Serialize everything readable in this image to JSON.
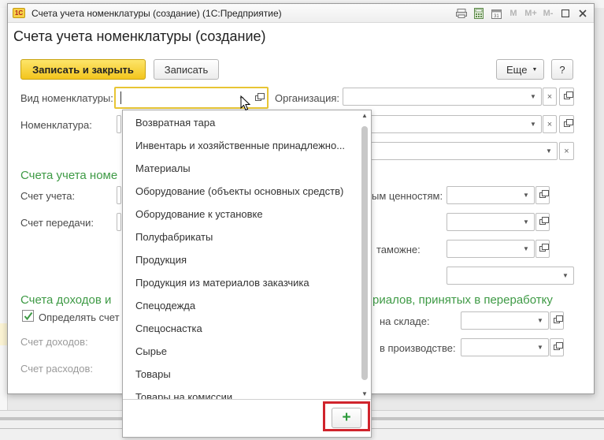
{
  "window": {
    "title": "Счета учета номенклатуры (создание)  (1С:Предприятие)",
    "form_title": "Счета учета номенклатуры (создание)",
    "titlebar_controls": [
      "M",
      "M+",
      "M-"
    ]
  },
  "toolbar": {
    "save_close_label": "Записать и закрыть",
    "save_label": "Записать",
    "more_label": "Еще",
    "help_label": "?"
  },
  "fields": {
    "item_type_label": "Вид номенклатуры:",
    "organization_label": "Организация:",
    "item_label": "Номенклатура:"
  },
  "sections": {
    "accounts_title": "Счета учета номе",
    "income_title": "Счета доходов и",
    "materials_title": "риалов, принятых в переработку"
  },
  "labels": {
    "account": "Счет учета:",
    "transfer_account": "Счет передачи:",
    "values_partial": "ым ценностям:",
    "customs_partial": "таможне:",
    "determine_check": "Определять счет",
    "income_account": "Счет доходов:",
    "expense_account": "Счет расходов:",
    "warehouse_partial": "на складе:",
    "production_partial": "в производстве:"
  },
  "dropdown": {
    "items": [
      "Возвратная тара",
      "Инвентарь и хозяйственные принадлежно...",
      "Материалы",
      "Оборудование (объекты основных средств)",
      "Оборудование к установке",
      "Полуфабрикаты",
      "Продукция",
      "Продукция из материалов заказчика",
      "Спецодежда",
      "Спецоснастка",
      "Сырье",
      "Товары",
      "Товары на комиссии"
    ],
    "add_button": "+"
  },
  "colors": {
    "accent_green": "#3e9a45",
    "primary_button": "#f3c51d",
    "highlight_frame": "#d0242c"
  }
}
